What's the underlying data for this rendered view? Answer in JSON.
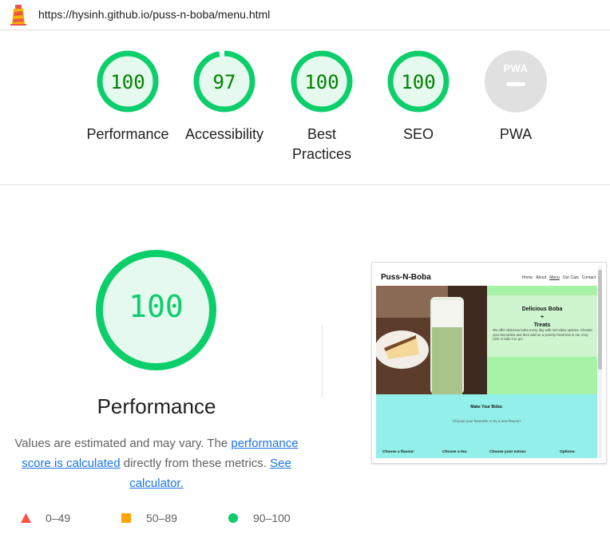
{
  "header": {
    "url": "https://hysinh.github.io/puss-n-boba/menu.html"
  },
  "colors": {
    "pass": "#0cce6b",
    "pass_text": "#008000",
    "pass_fill": "#e5f9ee",
    "average": "#ffa400",
    "fail": "#ff4e42",
    "na_gray": "#e0e0e0",
    "link": "#1a73e8"
  },
  "categories": [
    {
      "key": "performance",
      "score": "100",
      "label": "Performance",
      "score_fraction": 1.0
    },
    {
      "key": "accessibility",
      "score": "97",
      "label": "Accessibility",
      "score_fraction": 0.97
    },
    {
      "key": "best-practices",
      "score": "100",
      "label_line1": "Best",
      "label_line2": "Practices",
      "score_fraction": 1.0
    },
    {
      "key": "seo",
      "score": "100",
      "label": "SEO",
      "score_fraction": 1.0
    },
    {
      "key": "pwa",
      "label": "PWA",
      "badge": "PWA",
      "icon": "pwa-icon"
    }
  ],
  "performance": {
    "score": "100",
    "score_fraction": 1.0,
    "title": "Performance",
    "desc_part1": "Values are estimated and may vary. The ",
    "desc_link1": "performance score is calculated",
    "desc_part2": " directly from these metrics. ",
    "desc_link2": "See calculator."
  },
  "legend": [
    {
      "range": "0–49",
      "icon": "triangle-icon"
    },
    {
      "range": "50–89",
      "icon": "square-icon"
    },
    {
      "range": "90–100",
      "icon": "circle-icon"
    }
  ],
  "screenshot": {
    "brand": "Puss-N-Boba",
    "nav": [
      "Home",
      "About",
      "Menu",
      "Our Cats",
      "Contact"
    ],
    "card_title_line1": "Delicious Boba",
    "card_title_line2": "+",
    "card_title_line3": "Treats",
    "card_text": "We offer delicious boba every day with non-dairy options. Choose your favourites and then add on a yummy treat! Eat in our cozy cafe or take it to go!",
    "make_title": "Make Your Boba:",
    "make_sub": "Choose your favourite or try a new flavour!",
    "options": [
      "Choose a flavour:",
      "Choose a tea:",
      "Choose your extras:",
      "Options:"
    ]
  }
}
